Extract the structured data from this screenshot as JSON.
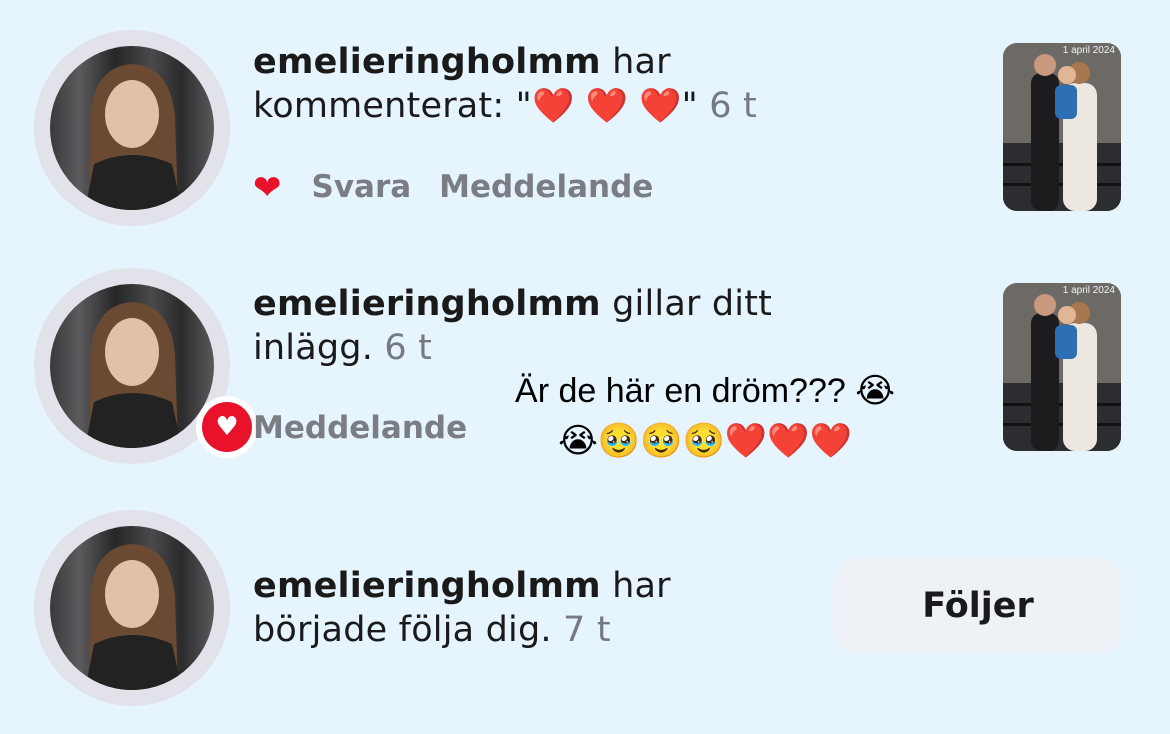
{
  "notifications": [
    {
      "username": "emelieringholmm",
      "action_text": " har kommenterat: \"",
      "comment_hearts": "❤️ ❤️ ❤️",
      "comment_end": "\"",
      "time": " 6 t",
      "actions": {
        "reply": "Svara",
        "message": "Meddelande"
      },
      "thumbnail_date": "1 april 2024"
    },
    {
      "username": "emelieringholmm",
      "action_text": " gillar ditt inlägg.",
      "time": " 6 t",
      "actions": {
        "message": "Meddelande"
      },
      "thumbnail_date": "1 april 2024"
    },
    {
      "username": "emelieringholmm",
      "action_text": " har började följa dig.",
      "time": " 7 t",
      "follow_button": "Följer"
    }
  ],
  "overlay_text": {
    "line1": "Är de här en dröm??? 😭",
    "line2": "😭🥹🥹🥹❤️❤️❤️"
  },
  "colors": {
    "background": "#e5f4fd",
    "like": "#e8132a",
    "muted": "#7a7d84"
  },
  "icons": {
    "like": "heart-icon",
    "badge": "heart-badge-icon"
  }
}
